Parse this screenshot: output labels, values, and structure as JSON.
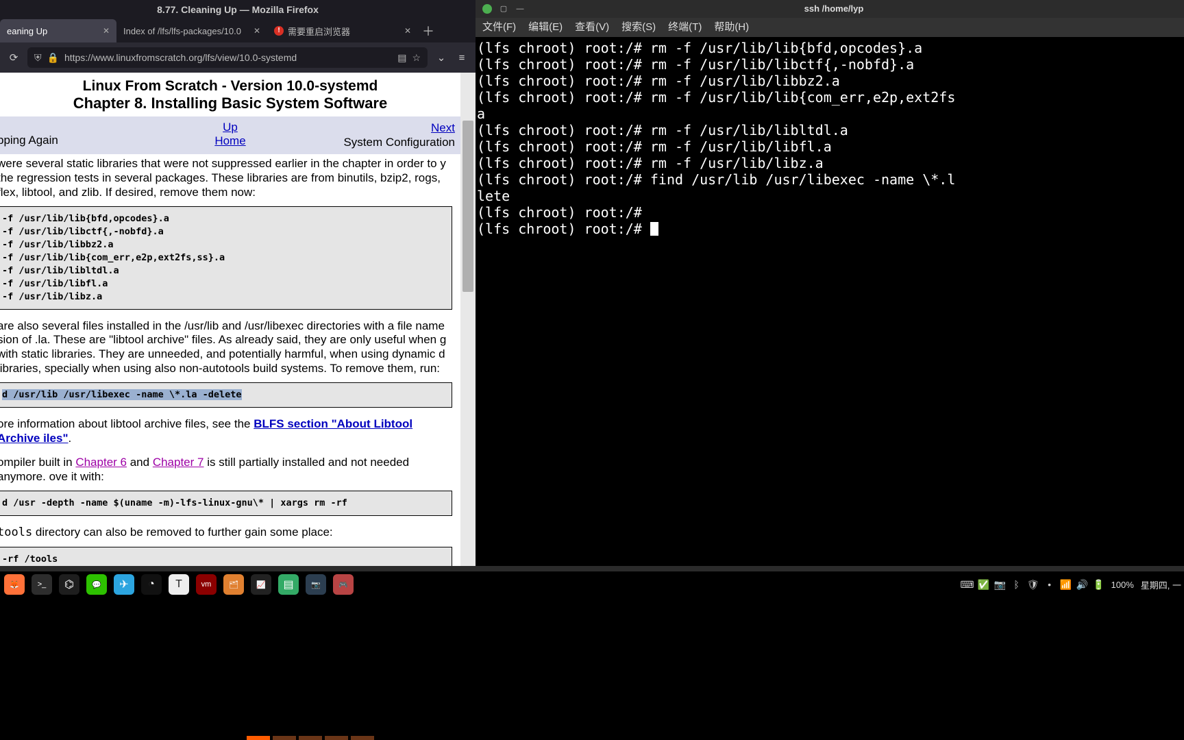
{
  "firefox": {
    "title": "8.77. Cleaning Up — Mozilla Firefox",
    "tabs": [
      {
        "label": "eaning Up",
        "active": true
      },
      {
        "label": "Index of /lfs/lfs-packages/10.0",
        "active": false
      },
      {
        "label": "需要重启浏览器",
        "active": false,
        "warn": true
      }
    ],
    "url": "https://www.linuxfromscratch.org/lfs/view/10.0-systemd"
  },
  "page": {
    "title1": "Linux From Scratch - Version 10.0-systemd",
    "title2": "Chapter 8. Installing Basic System Software",
    "nav": {
      "prev": "pping Again",
      "up": "Up",
      "home": "Home",
      "next": "Next",
      "next_sub": "System Configuration"
    },
    "para0": " were several static libraries that were not suppressed earlier in the chapter in order to y the regression tests in several packages. These libraries are from binutils, bzip2, rogs, flex, libtool, and zlib. If desired, remove them now:",
    "code1": "-f /usr/lib/lib{bfd,opcodes}.a\n-f /usr/lib/libctf{,-nobfd}.a\n-f /usr/lib/libbz2.a\n-f /usr/lib/lib{com_err,e2p,ext2fs,ss}.a\n-f /usr/lib/libltdl.a\n-f /usr/lib/libfl.a\n-f /usr/lib/libz.a",
    "para1": " are also several files installed in the /usr/lib and /usr/libexec directories with a file name sion of .la. These are \"libtool archive\" files. As already said, they are only useful when g with static libraries. They are unneeded, and potentially harmful, when using dynamic d libraries, specially when using also non-autotools build systems. To remove them, run:",
    "code2": "d /usr/lib /usr/libexec -name \\*.la -delete",
    "para2a": "ore information about libtool archive files, see the ",
    "link_blfs": "BLFS section \"About Libtool Archive iles\"",
    "para2b": ".",
    "para3a": "ompiler built in ",
    "link_ch6": "Chapter 6",
    "para3b": " and ",
    "link_ch7": "Chapter 7",
    "para3c": " is still partially installed and not needed anymore. ove it with:",
    "code3": "d /usr -depth -name $(uname -m)-lfs-linux-gnu\\* | xargs rm -rf",
    "para4a": "tools",
    "para4b": " directory can also be removed to further gain some place:",
    "code4": "-rf /tools"
  },
  "terminal": {
    "title": "ssh /home/lyp",
    "menu": [
      "文件(F)",
      "编辑(E)",
      "查看(V)",
      "搜索(S)",
      "终端(T)",
      "帮助(H)"
    ],
    "lines": [
      "(lfs chroot) root:/# rm -f /usr/lib/lib{bfd,opcodes}.a",
      "(lfs chroot) root:/# rm -f /usr/lib/libctf{,-nobfd}.a",
      "(lfs chroot) root:/# rm -f /usr/lib/libbz2.a",
      "(lfs chroot) root:/# rm -f /usr/lib/lib{com_err,e2p,ext2fs",
      "a",
      "(lfs chroot) root:/# rm -f /usr/lib/libltdl.a",
      "(lfs chroot) root:/# rm -f /usr/lib/libfl.a",
      "(lfs chroot) root:/# rm -f /usr/lib/libz.a",
      "(lfs chroot) root:/# find /usr/lib /usr/libexec -name \\*.l",
      "lete",
      "(lfs chroot) root:/# ",
      "(lfs chroot) root:/# "
    ]
  },
  "taskbar": {
    "apps": [
      {
        "name": "firefox-icon",
        "bg": "#ff7139",
        "glyph": "🦊"
      },
      {
        "name": "terminal-icon",
        "bg": "#2d2d2d",
        "glyph": ">_"
      },
      {
        "name": "vscode-icon",
        "bg": "#1e1e1e",
        "glyph": "⌬"
      },
      {
        "name": "wechat-icon",
        "bg": "#2dc100",
        "glyph": "💬"
      },
      {
        "name": "telegram-icon",
        "bg": "#2ca5e0",
        "glyph": "✈"
      },
      {
        "name": "music-icon",
        "bg": "#111",
        "glyph": "◔"
      },
      {
        "name": "text-icon",
        "bg": "#eee",
        "glyph": "T"
      },
      {
        "name": "vm-icon",
        "bg": "#8b0000",
        "glyph": "vm"
      },
      {
        "name": "files-icon",
        "bg": "#e08030",
        "glyph": "🗂"
      },
      {
        "name": "monitor-icon",
        "bg": "#222",
        "glyph": "📈"
      },
      {
        "name": "app-icon",
        "bg": "#3a6",
        "glyph": "▤"
      },
      {
        "name": "screenshot-icon",
        "bg": "#2c3e50",
        "glyph": "📷"
      },
      {
        "name": "game-icon",
        "bg": "#b84444",
        "glyph": "🎮"
      }
    ],
    "tray": [
      {
        "name": "keyboard-icon",
        "glyph": "⌨"
      },
      {
        "name": "check-icon",
        "glyph": "✅"
      },
      {
        "name": "camera-icon",
        "glyph": "📷"
      },
      {
        "name": "bluetooth-icon",
        "glyph": "ᛒ"
      },
      {
        "name": "shield-icon",
        "glyph": "🛡"
      },
      {
        "name": "dot-icon",
        "glyph": "•"
      },
      {
        "name": "wifi-icon",
        "glyph": "📶"
      },
      {
        "name": "volume-icon",
        "glyph": "🔊"
      },
      {
        "name": "battery-icon",
        "glyph": "🔋"
      }
    ],
    "battery": "100%",
    "clock": " 星期四, 一"
  }
}
